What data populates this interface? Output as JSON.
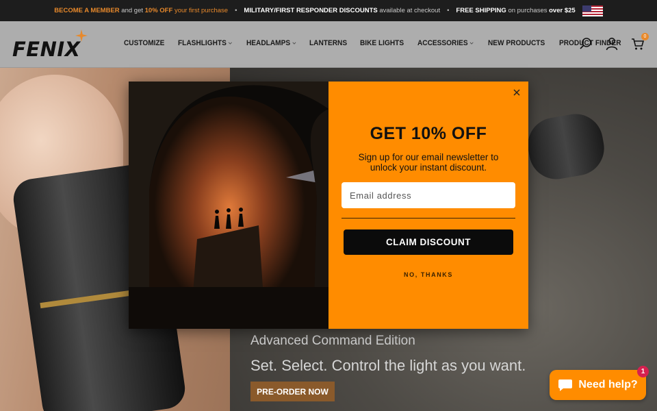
{
  "announcement": {
    "member_lead": "BECOME A MEMBER",
    "member_mid": "and get",
    "member_discount": "10% OFF",
    "member_tail": "your first purchase",
    "military_lead": "MILITARY/FIRST RESPONDER DISCOUNTS",
    "military_tail": "available at checkout",
    "shipping_lead": "FREE SHIPPING",
    "shipping_mid": "on purchases",
    "shipping_amount": "over $25",
    "separator": "•"
  },
  "header": {
    "logo_text": "FENIX",
    "nav": [
      {
        "label": "CUSTOMIZE",
        "has_dropdown": false
      },
      {
        "label": "FLASHLIGHTS",
        "has_dropdown": true
      },
      {
        "label": "HEADLAMPS",
        "has_dropdown": true
      },
      {
        "label": "LANTERNS",
        "has_dropdown": false
      },
      {
        "label": "BIKE LIGHTS",
        "has_dropdown": false
      },
      {
        "label": "ACCESSORIES",
        "has_dropdown": true
      },
      {
        "label": "NEW PRODUCTS",
        "has_dropdown": false
      },
      {
        "label": "PRODUCT FINDER",
        "has_dropdown": false
      }
    ],
    "cart_count": "0",
    "icons": [
      "search-icon",
      "account-icon",
      "cart-icon"
    ]
  },
  "hero": {
    "subtitle": "Advanced Command Edition",
    "tagline": "Set. Select. Control the light as you want.",
    "cta_label": "PRE-ORDER NOW"
  },
  "modal": {
    "title": "GET 10% OFF",
    "description": "Sign up for our email newsletter to unlock your instant discount.",
    "email_placeholder": "Email address",
    "email_value": "",
    "submit_label": "CLAIM DISCOUNT",
    "decline_label": "NO, THANKS"
  },
  "chat": {
    "label": "Need help?",
    "badge_count": "1"
  },
  "colors": {
    "accent": "#ff8c00",
    "topbar_bg": "#1d1d1d",
    "header_bg": "#adadad",
    "cta_bg": "#8a5a2b",
    "badge": "#d6204f"
  }
}
